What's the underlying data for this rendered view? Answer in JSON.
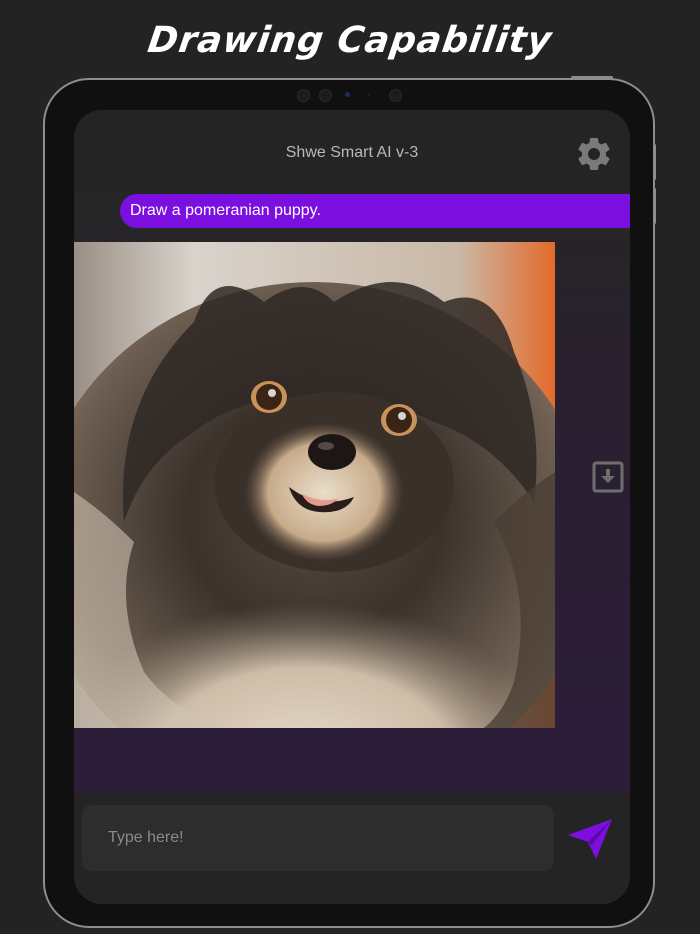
{
  "headline": "Drawing Capability",
  "app": {
    "title": "Shwe Smart AI v-3"
  },
  "chat": {
    "user_message": "Draw a pomeranian puppy."
  },
  "input": {
    "placeholder": "Type here!"
  },
  "icons": {
    "settings": "gear-icon",
    "download": "download-icon",
    "send": "send-icon"
  },
  "colors": {
    "accent": "#7b0fe0",
    "background": "#232323",
    "chat_bg": "#2c1d3a"
  }
}
